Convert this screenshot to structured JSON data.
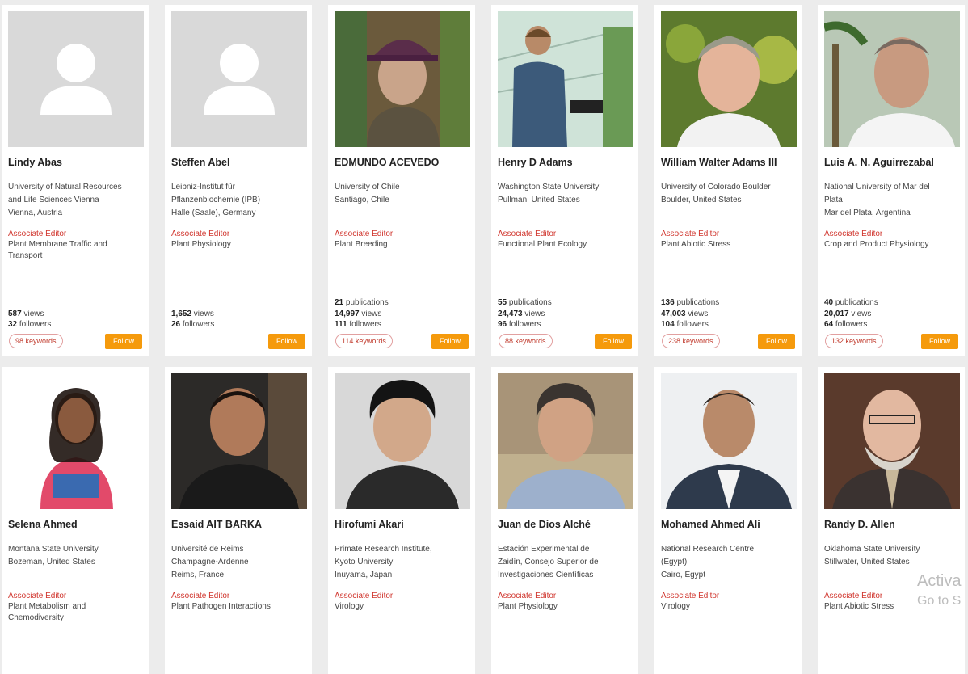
{
  "watermark": {
    "line1": "Activa",
    "line2": "Go to S"
  },
  "editors": [
    {
      "name": "Lindy Abas",
      "aff": [
        "University of Natural Resources",
        "and Life Sciences Vienna",
        "Vienna, Austria"
      ],
      "role": "Associate Editor",
      "section": [
        "Plant Membrane Traffic and",
        "Transport"
      ],
      "stats": [
        "",
        "587 views",
        "32 followers"
      ],
      "keywords": "98 keywords",
      "follow": "Follow",
      "photo": "placeholder"
    },
    {
      "name": "Steffen Abel",
      "aff": [
        "Leibniz-Institut für",
        "Pflanzenbiochemie (IPB)",
        "Halle (Saale), Germany"
      ],
      "role": "Associate Editor",
      "section": [
        "Plant Physiology",
        ""
      ],
      "stats": [
        "",
        "1,652 views",
        "26 followers"
      ],
      "keywords": "",
      "follow": "Follow",
      "photo": "placeholder"
    },
    {
      "name": "EDMUNDO ACEVEDO",
      "aff": [
        "University of Chile",
        "Santiago, Chile",
        ""
      ],
      "role": "Associate Editor",
      "section": [
        "Plant Breeding",
        ""
      ],
      "stats": [
        "21 publications",
        "14,997 views",
        "111 followers"
      ],
      "keywords": "114 keywords",
      "follow": "Follow",
      "photo": "hat"
    },
    {
      "name": "Henry D Adams",
      "aff": [
        "Washington State University",
        "Pullman, United States",
        ""
      ],
      "role": "Associate Editor",
      "section": [
        "Functional Plant Ecology",
        ""
      ],
      "stats": [
        "55 publications",
        "24,473 views",
        "96 followers"
      ],
      "keywords": "88 keywords",
      "follow": "Follow",
      "photo": "greenhouse"
    },
    {
      "name": "William Walter Adams III",
      "aff": [
        "University of Colorado Boulder",
        "Boulder, United States",
        ""
      ],
      "role": "Associate Editor",
      "section": [
        "Plant Abiotic Stress",
        ""
      ],
      "stats": [
        "136 publications",
        "47,003 views",
        "104 followers"
      ],
      "keywords": "238 keywords",
      "follow": "Follow",
      "photo": "outdoor"
    },
    {
      "name": "Luis A. N. Aguirrezabal",
      "aff": [
        "National University of Mar del",
        "Plata",
        "Mar del Plata, Argentina"
      ],
      "role": "Associate Editor",
      "section": [
        "Crop and Product Physiology",
        ""
      ],
      "stats": [
        "40 publications",
        "20,017 views",
        "64 followers"
      ],
      "keywords": "132 keywords",
      "follow": "Follow",
      "photo": "palm"
    },
    {
      "name": "Selena Ahmed",
      "aff": [
        "Montana State University",
        "Bozeman, United States",
        ""
      ],
      "role": "Associate Editor",
      "section": [
        "Plant Metabolism and",
        "Chemodiversity"
      ],
      "photo": "woman"
    },
    {
      "name": "Essaid AIT BARKA",
      "aff": [
        "Université de Reims",
        "Champagne-Ardenne",
        "Reims, France"
      ],
      "role": "Associate Editor",
      "section": [
        "Plant Pathogen Interactions",
        ""
      ],
      "photo": "dark"
    },
    {
      "name": "Hirofumi Akari",
      "aff": [
        "Primate Research Institute,",
        "Kyoto University",
        "Inuyama, Japan"
      ],
      "role": "Associate Editor",
      "section": [
        "Virology",
        ""
      ],
      "photo": "studio"
    },
    {
      "name": "Juan de Dios Alché",
      "aff": [
        "Estación Experimental de",
        "Zaidín, Consejo Superior de",
        "Investigaciones Científicas"
      ],
      "role": "Associate Editor",
      "section": [
        "Plant Physiology",
        ""
      ],
      "photo": "stone"
    },
    {
      "name": "Mohamed Ahmed Ali",
      "aff": [
        "National Research Centre",
        "(Egypt)",
        "Cairo, Egypt"
      ],
      "role": "Associate Editor",
      "section": [
        "Virology",
        ""
      ],
      "photo": "suit"
    },
    {
      "name": "Randy D. Allen",
      "aff": [
        "Oklahoma State University",
        "Stillwater, United States",
        ""
      ],
      "role": "Associate Editor",
      "section": [
        "Plant Abiotic Stress",
        ""
      ],
      "photo": "brown"
    }
  ]
}
